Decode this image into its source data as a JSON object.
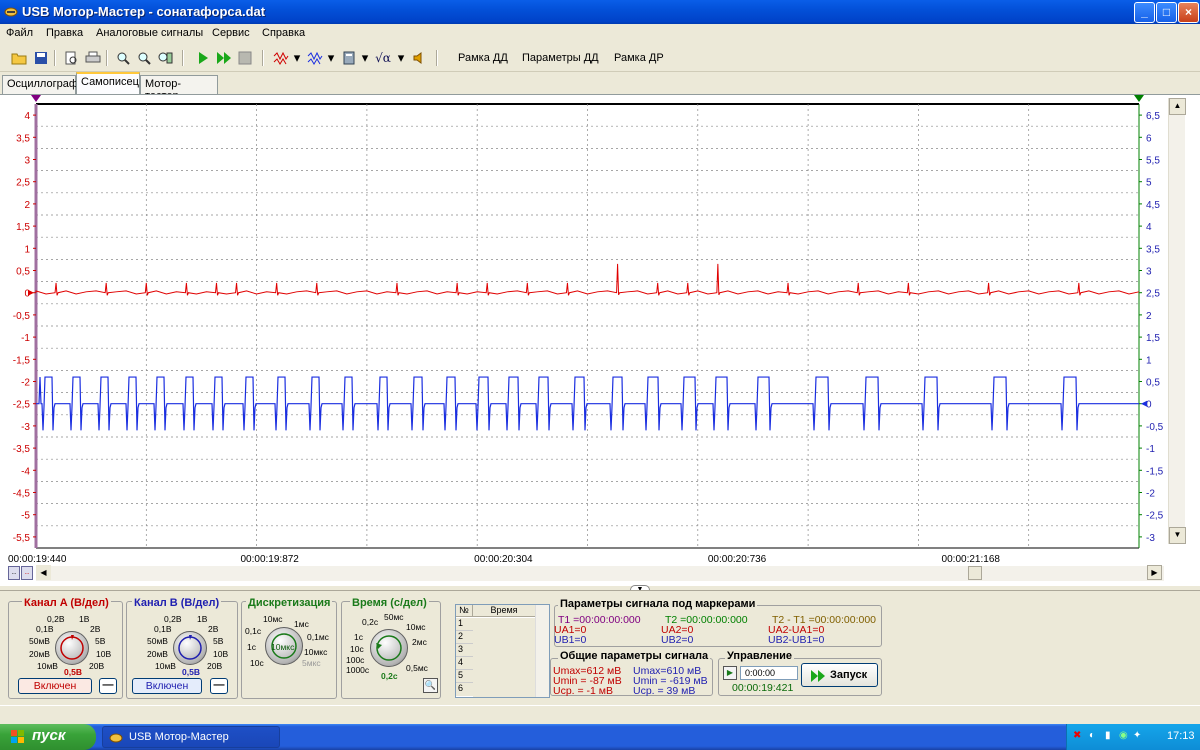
{
  "window": {
    "title": "USB Мотор-Мастер - сонатафорса.dat",
    "buttons": {
      "minimize": "_",
      "maximize": "□",
      "close": "×"
    }
  },
  "menu": [
    "Файл",
    "Правка",
    "Аналоговые сигналы",
    "Сервис",
    "Справка"
  ],
  "toolbar": {
    "text_buttons": [
      "Рамка ДД",
      "Параметры ДД",
      "Рамка ДР"
    ]
  },
  "tabs": [
    {
      "label": "Осциллограф",
      "active": false
    },
    {
      "label": "Самописец",
      "active": true
    },
    {
      "label": "Мотор-тестер",
      "active": false
    }
  ],
  "chart_data": {
    "type": "line",
    "title": "",
    "left_axis": {
      "color": "#cc0000",
      "ticks": [
        "4",
        "3,5",
        "3",
        "2,5",
        "2",
        "1,5",
        "1",
        "0,5",
        "0",
        "-0,5",
        "-1",
        "-1,5",
        "-2",
        "-2,5",
        "-3",
        "-3,5",
        "-4",
        "-4,5",
        "-5",
        "-5,5"
      ],
      "range": [
        -5.75,
        4.25
      ]
    },
    "right_axis": {
      "color": "#1f1fb0",
      "ticks": [
        "6,5",
        "6",
        "5,5",
        "5",
        "4,5",
        "4",
        "3,5",
        "3",
        "2,5",
        "2",
        "1,5",
        "1",
        "0,5",
        "0",
        "-0,5",
        "-1",
        "-1,5",
        "-2",
        "-2,5",
        "-3"
      ],
      "range": [
        -3.25,
        6.75
      ]
    },
    "x_ticks": [
      "00:00:19:440",
      "00:00:19:872",
      "00:00:20:304",
      "00:00:20:736",
      "00:00:21:168"
    ],
    "grid": true,
    "series": [
      {
        "color": "#e00000",
        "axis": "left",
        "baseline": 0,
        "spikes_ms": [
          -1,
          2,
          7,
          11,
          15,
          18,
          20,
          24,
          28,
          36,
          42,
          45,
          49,
          53,
          58,
          62,
          65,
          68,
          75,
          82,
          87,
          95,
          104
        ],
        "large_spike": [
          {
            "x_index": 58,
            "value": 0.65
          },
          {
            "x_index": 68,
            "value": 0.65
          }
        ]
      },
      {
        "color": "#1a2ee0",
        "axis": "right",
        "baseline": 0,
        "pulse_high": 0.6,
        "pulse_low": -0.6,
        "pulses": [
          {
            "x": 45,
            "w": 7
          },
          {
            "x": 73,
            "w": 7
          },
          {
            "x": 101,
            "w": 7
          },
          {
            "x": 129,
            "w": 7
          },
          {
            "x": 157,
            "w": 7
          },
          {
            "x": 186,
            "w": 7
          },
          {
            "x": 215,
            "w": 7
          },
          {
            "x": 246,
            "w": 7
          },
          {
            "x": 278,
            "w": 7
          },
          {
            "x": 312,
            "w": 7
          },
          {
            "x": 345,
            "w": 7
          },
          {
            "x": 380,
            "w": 7
          },
          {
            "x": 414,
            "w": 8
          },
          {
            "x": 447,
            "w": 8
          },
          {
            "x": 479,
            "w": 9
          },
          {
            "x": 509,
            "w": 9
          },
          {
            "x": 539,
            "w": 9
          },
          {
            "x": 575,
            "w": 9
          },
          {
            "x": 613,
            "w": 9
          },
          {
            "x": 648,
            "w": 10
          },
          {
            "x": 684,
            "w": 11
          },
          {
            "x": 716,
            "w": 11
          },
          {
            "x": 758,
            "w": 11
          },
          {
            "x": 816,
            "w": 12
          },
          {
            "x": 866,
            "w": 12
          },
          {
            "x": 925,
            "w": 12
          },
          {
            "x": 994,
            "w": 12
          },
          {
            "x": 1064,
            "w": 12
          }
        ]
      }
    ]
  },
  "hscroll": {
    "left_labels": [
      "..",
      ".."
    ]
  },
  "channel_a": {
    "title": "Канал A (В/дел)",
    "labels": [
      "0,2В",
      "1В",
      "0,1В",
      "2В",
      "50мВ",
      "5В",
      "20мВ",
      "10В",
      "10мВ",
      "20В",
      "0,5В"
    ],
    "button": "Включен",
    "minus": "—",
    "color": "#c00000"
  },
  "channel_b": {
    "title": "Канал B (В/дел)",
    "labels": [
      "0,2В",
      "1В",
      "0,1В",
      "2В",
      "50мВ",
      "5В",
      "20мВ",
      "10В",
      "10мВ",
      "20В",
      "0,5В"
    ],
    "button": "Включен",
    "minus": "—",
    "color": "#1f1fb0"
  },
  "sampling": {
    "title": "Дискретизация",
    "labels": [
      "10мс",
      "1мс",
      "0,1с",
      "0,1мс",
      "1с",
      "10мкс",
      "10с",
      "5мкс",
      "10мкс"
    ]
  },
  "timebase": {
    "title": "Время (с/дел)",
    "labels": [
      "50мс",
      "0,2с",
      "10мс",
      "1с",
      "2мс",
      "10с",
      "100с",
      "1000с",
      "0,5мс",
      "0,2с"
    ]
  },
  "table": {
    "col_num": "№",
    "col_time": "Время",
    "rows": [
      "1",
      "2",
      "3",
      "4",
      "5",
      "6"
    ]
  },
  "markers": {
    "title": "Параметры сигнала под маркерами",
    "t1": "T1 =00:00:00:000",
    "t2": "T2 =00:00:00:000",
    "dt": "T2 - T1 =00:00:00:000",
    "ua1": "UA1=0",
    "ua2": "UA2=0",
    "dua": "UA2-UA1=0",
    "ub1": "UB1=0",
    "ub2": "UB2=0",
    "dub": "UB2-UB1=0"
  },
  "general": {
    "title": "Общие параметры сигнала",
    "a_umax": "Umax=612 мВ",
    "a_umin": "Umin = -87 мВ",
    "a_ucp": "Uср. =  -1 мВ",
    "b_umax": "Umax=610 мВ",
    "b_umin": "Umin = -619 мВ",
    "b_ucp": "Uср. =  39 мВ"
  },
  "control": {
    "title": "Управление",
    "time_value": "0:00:00",
    "elapsed": "00:00:19:421",
    "start_button": "Запуск"
  },
  "taskbar": {
    "start": "пуск",
    "item": "USB Мотор-Мастер",
    "clock": "17:13"
  }
}
